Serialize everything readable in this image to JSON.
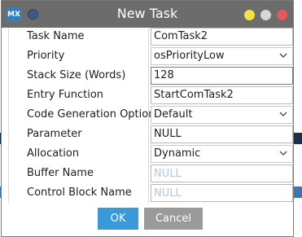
{
  "window": {
    "title": "New Task",
    "logo_text": "MX"
  },
  "form": {
    "rows": [
      {
        "label": "Task Name",
        "value": "ComTask2",
        "kind": "text"
      },
      {
        "label": "Priority",
        "value": "osPriorityLow",
        "kind": "combo"
      },
      {
        "label": "Stack Size (Words)",
        "value": "128",
        "kind": "text-focused"
      },
      {
        "label": "Entry Function",
        "value": "StartComTask2",
        "kind": "text"
      },
      {
        "label": "Code Generation Option",
        "value": "Default",
        "kind": "combo"
      },
      {
        "label": "Parameter",
        "value": "NULL",
        "kind": "text"
      },
      {
        "label": "Allocation",
        "value": "Dynamic",
        "kind": "combo"
      },
      {
        "label": "Buffer Name",
        "placeholder": "NULL",
        "kind": "placeholder"
      },
      {
        "label": "Control Block Name",
        "placeholder": "NULL",
        "kind": "placeholder"
      }
    ]
  },
  "buttons": {
    "ok": "OK",
    "cancel": "Cancel"
  },
  "colors": {
    "titlebar": "#6c6c6c",
    "ok": "#3a9ad9",
    "cancel": "#9a9a9a",
    "minimize": "#f3e04a",
    "maximize": "#d7d7d7",
    "close": "#e05a59"
  }
}
